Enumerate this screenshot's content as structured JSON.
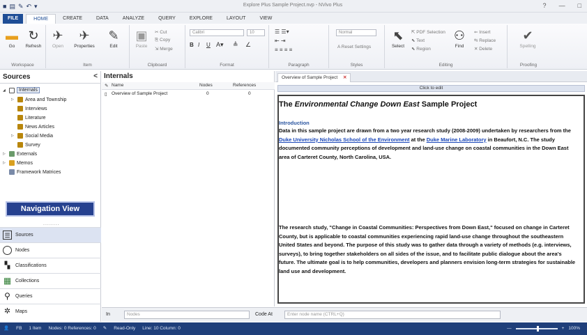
{
  "window": {
    "title": "Explore Plus Sample Project.nvp - NVivo Plus",
    "help": "?",
    "minimize": "—",
    "maximize": "□"
  },
  "menu": {
    "tabs": [
      "FILE",
      "HOME",
      "CREATE",
      "DATA",
      "ANALYZE",
      "QUERY",
      "EXPLORE",
      "LAYOUT",
      "VIEW"
    ],
    "active": "HOME"
  },
  "ribbon": {
    "groups": {
      "workspace": "Workspace",
      "item": "Item",
      "clipboard": "Clipboard",
      "format": "Format",
      "paragraph": "Paragraph",
      "styles": "Styles",
      "editing": "Editing",
      "proofing": "Proofing"
    },
    "buttons": {
      "go": "Go",
      "refresh": "Refresh",
      "open": "Open",
      "properties": "Properties",
      "edit": "Edit",
      "paste": "Paste",
      "cut": "Cut",
      "copy": "Copy",
      "merge": "Merge",
      "select": "Select",
      "find": "Find",
      "spelling": "Spelling",
      "pdf_selection": "PDF Selection",
      "text": "Text",
      "region": "Region",
      "insert": "Insert",
      "replace": "Replace",
      "delete": "Delete",
      "reset_settings": "Reset Settings"
    },
    "font_name": "Calibri",
    "font_size": "10",
    "style_name": "Normal",
    "format_bold": "B",
    "format_italic": "I",
    "format_underline": "U"
  },
  "sources_panel": {
    "title": "Sources",
    "collapse": "<",
    "tree": [
      {
        "label": "Internals",
        "expanded": true
      },
      {
        "label": "Area and Township"
      },
      {
        "label": "Interviews"
      },
      {
        "label": "Literature"
      },
      {
        "label": "News Articles"
      },
      {
        "label": "Social Media"
      },
      {
        "label": "Survey"
      },
      {
        "label": "Externals"
      },
      {
        "label": "Memos"
      },
      {
        "label": "Framework Matrices"
      }
    ],
    "nav_view_label": "Navigation View",
    "dots": "........",
    "nav_buttons": [
      "Sources",
      "Nodes",
      "Classifications",
      "Collections",
      "Queries",
      "Maps"
    ]
  },
  "list_view": {
    "title": "Internals",
    "columns": [
      "Name",
      "Nodes",
      "References"
    ],
    "rows": [
      {
        "name": "Overview of Sample Project",
        "nodes": "0",
        "references": "0"
      }
    ]
  },
  "document": {
    "tab_label": "Overview of Sample Project",
    "tab_close": "✕",
    "click_to_edit": "Click to edit",
    "title_pre": "The ",
    "title_em": "Environmental Change Down East",
    "title_post": " Sample Project",
    "intro_heading": "Introduction",
    "p1_a": "Data in this sample project are drawn from a two year research study (2008-2009) undertaken by researchers from the ",
    "p1_link1": "Duke University Nicholas School of the Environment",
    "p1_b": " at the ",
    "p1_link2": "Duke Marine Laboratory",
    "p1_c": " in Beaufort, N.C. The study documented community perceptions of development and land-use change on coastal communities in the Down East area of Carteret County, North Carolina, USA.",
    "p2": "The research study, \"Change in Coastal Communities: Perspectives from Down East,\" focused on change in Carteret County, but is applicable to coastal communities experiencing rapid land-use change throughout the southeastern United States and beyond. The purpose of this study was to gather data through a variety of methods (e.g. interviews, surveys), to bring together stakeholders on all sides of the issue, and to facilitate public dialogue about the area's future. The ultimate goal is to help communities, developers and planners envision long-term strategies for sustainable land use and development."
  },
  "bottom_bar": {
    "in_label": "In",
    "nodes_placeholder": "Nodes",
    "code_at_label": "Code At",
    "code_at_placeholder": "Enter node name (CTRL+Q)"
  },
  "status_bar": {
    "user": "FB",
    "items": "1 Item",
    "nodes_refs": "Nodes: 0  References: 0",
    "read_only": "Read-Only",
    "line_col": "Line: 10  Column: 0",
    "zoom_minus": "—",
    "zoom_plus": "+",
    "zoom_percent": "100%"
  }
}
